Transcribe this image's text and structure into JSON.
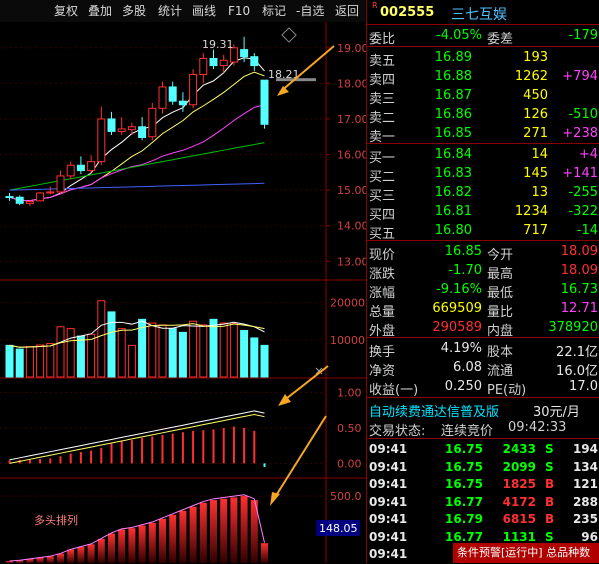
{
  "toolbar": {
    "items": [
      "复权",
      "叠加",
      "多股",
      "统计",
      "画线",
      "F10",
      "标记",
      "-自选",
      "返回"
    ]
  },
  "stock": {
    "badge": "R",
    "code": "002555",
    "name": "三七互娱"
  },
  "quote": {
    "weibi_label": "委比",
    "weibi": "-4.05%",
    "weicha_label": "委差",
    "weicha": "-179",
    "sell": [
      {
        "label": "卖五",
        "price": "16.89",
        "vol": "193",
        "chg": ""
      },
      {
        "label": "卖四",
        "price": "16.88",
        "vol": "1262",
        "chg": "+794"
      },
      {
        "label": "卖三",
        "price": "16.87",
        "vol": "450",
        "chg": ""
      },
      {
        "label": "卖二",
        "price": "16.86",
        "vol": "126",
        "chg": "-510"
      },
      {
        "label": "卖一",
        "price": "16.85",
        "vol": "271",
        "chg": "+238"
      }
    ],
    "buy": [
      {
        "label": "买一",
        "price": "16.84",
        "vol": "14",
        "chg": "+4"
      },
      {
        "label": "买二",
        "price": "16.83",
        "vol": "145",
        "chg": "+141"
      },
      {
        "label": "买三",
        "price": "16.82",
        "vol": "13",
        "chg": "-255"
      },
      {
        "label": "买四",
        "price": "16.81",
        "vol": "1234",
        "chg": "-322"
      },
      {
        "label": "买五",
        "price": "16.80",
        "vol": "717",
        "chg": "-14"
      }
    ],
    "stats": [
      {
        "l1": "现价",
        "v1": "16.85",
        "l2": "今开",
        "v2": "18.09"
      },
      {
        "l1": "涨跌",
        "v1": "-1.70",
        "l2": "最高",
        "v2": "18.09"
      },
      {
        "l1": "涨幅",
        "v1": "-9.16%",
        "l2": "最低",
        "v2": "16.73"
      },
      {
        "l1": "总量",
        "v1": "669509",
        "l2": "量比",
        "v2": "12.71"
      },
      {
        "l1": "外盘",
        "v1": "290589",
        "l2": "内盘",
        "v2": "378920"
      }
    ],
    "stats2": [
      {
        "l1": "换手",
        "v1": "4.19%",
        "l2": "股本",
        "v2": "22.1亿"
      },
      {
        "l1": "净资",
        "v1": "6.08",
        "l2": "流通",
        "v2": "16.0亿"
      },
      {
        "l1": "收益(一)",
        "v1": "0.250",
        "l2": "PE(动)",
        "v2": "17.0"
      }
    ],
    "service_text": "自动续费通达信普及版",
    "service_price": "30元/月",
    "trade_status_label": "交易状态:",
    "trade_status": "连续竞价",
    "trade_time": "09:42:33"
  },
  "ticks": [
    {
      "t": "09:41",
      "p": "16.75",
      "v": "2433",
      "s": "S",
      "n": "194"
    },
    {
      "t": "09:41",
      "p": "16.75",
      "v": "2099",
      "s": "S",
      "n": "134"
    },
    {
      "t": "09:41",
      "p": "16.75",
      "v": "1825",
      "s": "B",
      "n": "121"
    },
    {
      "t": "09:41",
      "p": "16.77",
      "v": "4172",
      "s": "B",
      "n": "288"
    },
    {
      "t": "09:41",
      "p": "16.79",
      "v": "6815",
      "s": "B",
      "n": "235"
    },
    {
      "t": "09:41",
      "p": "16.77",
      "v": "1131",
      "s": "S",
      "n": "96"
    },
    {
      "t": "09:41",
      "p": "",
      "v": "",
      "s": "",
      "n": ""
    }
  ],
  "alert": "条件预警[运行中] 总品种数",
  "chart_data": {
    "type": "candlestick",
    "price_axis": [
      "19.00",
      "18.00",
      "17.00",
      "16.00",
      "15.00",
      "14.00",
      "13.00"
    ],
    "price_ylim": [
      12.7,
      19.5
    ],
    "high_label": "19.31",
    "last_label": "18.21",
    "volume_axis": [
      "20000",
      "10000"
    ],
    "vol_ylim": [
      0,
      25000
    ],
    "macd_axis": [
      "1.00",
      "0.50",
      "0.00"
    ],
    "macd_ylim": [
      -0.15,
      1.15
    ],
    "bottom_axis": [
      "500.0"
    ],
    "bottom_ylim": [
      0,
      620
    ],
    "bottom_label": "多头排列",
    "bottom_value": "148.05",
    "candles": [
      {
        "o": 14.82,
        "h": 14.92,
        "l": 14.7,
        "c": 14.8
      },
      {
        "o": 14.8,
        "h": 14.85,
        "l": 14.58,
        "c": 14.63
      },
      {
        "o": 14.63,
        "h": 14.72,
        "l": 14.55,
        "c": 14.68
      },
      {
        "o": 14.7,
        "h": 14.95,
        "l": 14.68,
        "c": 14.92
      },
      {
        "o": 14.92,
        "h": 15.1,
        "l": 14.88,
        "c": 14.95
      },
      {
        "o": 14.95,
        "h": 15.55,
        "l": 14.9,
        "c": 15.4
      },
      {
        "o": 15.4,
        "h": 15.8,
        "l": 15.3,
        "c": 15.7
      },
      {
        "o": 15.7,
        "h": 15.95,
        "l": 15.45,
        "c": 15.55
      },
      {
        "o": 15.55,
        "h": 15.98,
        "l": 15.5,
        "c": 15.8
      },
      {
        "o": 15.8,
        "h": 17.35,
        "l": 15.7,
        "c": 17.0
      },
      {
        "o": 17.0,
        "h": 17.2,
        "l": 16.55,
        "c": 16.65
      },
      {
        "o": 16.65,
        "h": 17.05,
        "l": 16.55,
        "c": 16.72
      },
      {
        "o": 16.7,
        "h": 16.9,
        "l": 16.55,
        "c": 16.78
      },
      {
        "o": 16.78,
        "h": 17.05,
        "l": 16.4,
        "c": 16.48
      },
      {
        "o": 16.5,
        "h": 17.45,
        "l": 16.4,
        "c": 17.3
      },
      {
        "o": 17.3,
        "h": 18.05,
        "l": 17.15,
        "c": 17.9
      },
      {
        "o": 17.9,
        "h": 18.05,
        "l": 17.4,
        "c": 17.5
      },
      {
        "o": 17.5,
        "h": 17.75,
        "l": 17.2,
        "c": 17.4
      },
      {
        "o": 17.4,
        "h": 18.4,
        "l": 17.3,
        "c": 18.25
      },
      {
        "o": 18.25,
        "h": 18.85,
        "l": 18.0,
        "c": 18.7
      },
      {
        "o": 18.7,
        "h": 18.95,
        "l": 18.4,
        "c": 18.5
      },
      {
        "o": 18.5,
        "h": 18.8,
        "l": 18.3,
        "c": 18.65
      },
      {
        "o": 18.6,
        "h": 19.1,
        "l": 18.5,
        "c": 19.0
      },
      {
        "o": 18.95,
        "h": 19.31,
        "l": 18.6,
        "c": 18.75
      },
      {
        "o": 18.75,
        "h": 18.85,
        "l": 18.35,
        "c": 18.5
      },
      {
        "o": 18.09,
        "h": 18.09,
        "l": 16.73,
        "c": 16.85
      }
    ],
    "volumes": [
      8500,
      7500,
      8200,
      8600,
      9000,
      13500,
      13000,
      11000,
      11500,
      20500,
      17500,
      13000,
      8500,
      15500,
      14500,
      14000,
      13000,
      12000,
      15000,
      14000,
      15500,
      14500,
      14500,
      12500,
      10500,
      8500
    ],
    "macd_bars": [
      0.04,
      0.05,
      0.05,
      0.06,
      0.07,
      0.1,
      0.14,
      0.16,
      0.18,
      0.22,
      0.28,
      0.31,
      0.33,
      0.36,
      0.38,
      0.4,
      0.42,
      0.44,
      0.46,
      0.47,
      0.48,
      0.5,
      0.52,
      0.5,
      0.46,
      -0.05
    ],
    "bottom_bars": [
      15,
      20,
      30,
      40,
      50,
      70,
      100,
      120,
      140,
      180,
      220,
      250,
      260,
      280,
      300,
      330,
      360,
      390,
      420,
      450,
      470,
      480,
      490,
      500,
      470,
      148
    ]
  }
}
